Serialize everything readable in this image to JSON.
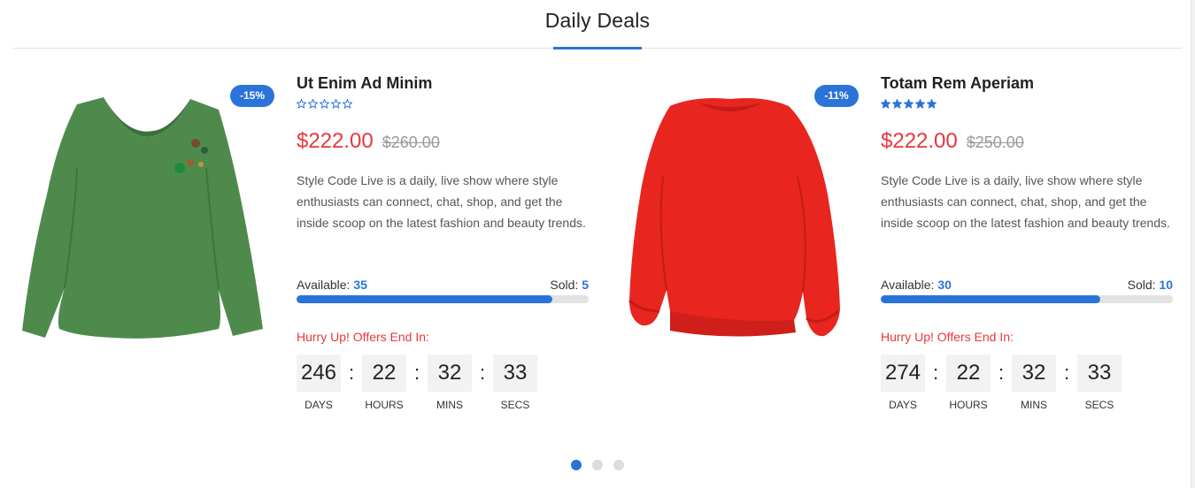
{
  "section": {
    "title": "Daily Deals"
  },
  "colors": {
    "accent": "#2a73d9",
    "sale": "#e8373c",
    "track": "#e2e2e2"
  },
  "deals": [
    {
      "name": "Ut Enim Ad Minim",
      "discount": "-15%",
      "rating": 0,
      "rating_max": 5,
      "price_new": "$222.00",
      "price_old": "$260.00",
      "description": "Style Code Live is a daily, live show where style enthusiasts can connect, chat, shop, and get the inside scoop on the latest fashion and beauty trends.",
      "available_label": "Available:",
      "available": "35",
      "sold_label": "Sold:",
      "sold": "5",
      "sold_fraction": 0.875,
      "hurry": "Hurry Up! Offers End In:",
      "countdown": {
        "days": "246",
        "hours": "22",
        "mins": "32",
        "secs": "33"
      },
      "countdown_labels": {
        "days": "DAYS",
        "hours": "HOURS",
        "mins": "MINS",
        "secs": "SECS"
      },
      "image": "green-sweater"
    },
    {
      "name": "Totam Rem Aperiam",
      "discount": "-11%",
      "rating": 5,
      "rating_max": 5,
      "price_new": "$222.00",
      "price_old": "$250.00",
      "description": "Style Code Live is a daily, live show where style enthusiasts can connect, chat, shop, and get the inside scoop on the latest fashion and beauty trends.",
      "available_label": "Available:",
      "available": "30",
      "sold_label": "Sold:",
      "sold": "10",
      "sold_fraction": 0.75,
      "hurry": "Hurry Up! Offers End In:",
      "countdown": {
        "days": "274",
        "hours": "22",
        "mins": "32",
        "secs": "33"
      },
      "countdown_labels": {
        "days": "DAYS",
        "hours": "HOURS",
        "mins": "MINS",
        "secs": "SECS"
      },
      "image": "red-sweater"
    }
  ],
  "pagination": {
    "count": 3,
    "active": 0
  },
  "countdown_separator": ":"
}
